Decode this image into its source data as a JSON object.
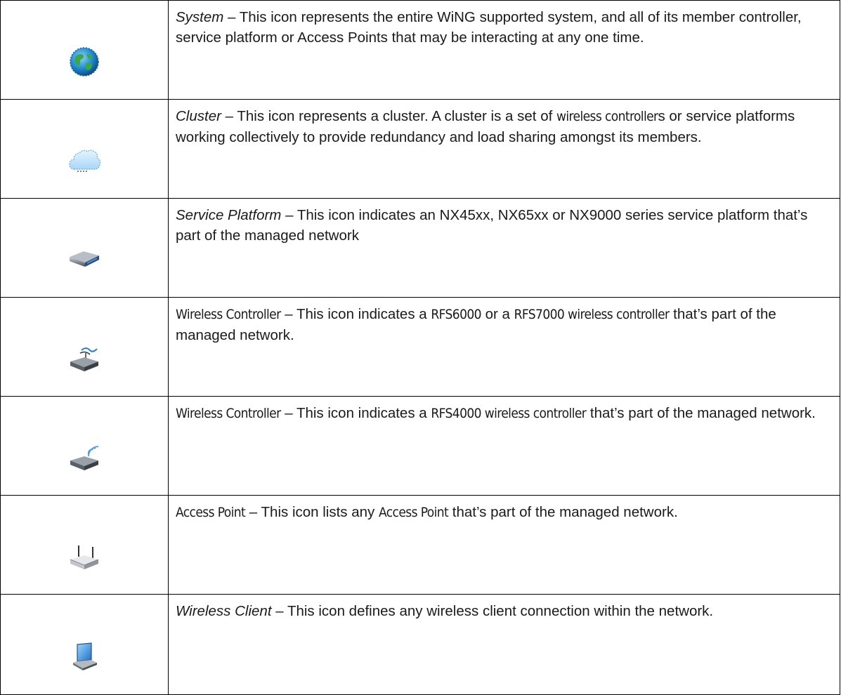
{
  "rows": [
    {
      "icon": "globe-icon",
      "term": "System",
      "desc": " – This icon represents the entire WiNG supported system, and all of its member controller, service platform or Access Points that may be interacting at any one time."
    },
    {
      "icon": "cloud-icon",
      "term": "Cluster",
      "desc_a": " – This icon represents a cluster. A cluster is a set of ",
      "desc_b": "wireless controller",
      "desc_c": "s or service platforms working collectively to provide redundancy and load sharing amongst its members."
    },
    {
      "icon": "service-platform-icon",
      "term": "Service Platform",
      "desc": " – This icon indicates an NX45xx, NX65xx or NX9000 series service platform that’s part of the managed network"
    },
    {
      "icon": "wireless-controller-antenna-icon",
      "term": "Wireless Controller",
      "desc_a": " – This icon indicates a ",
      "desc_b": "RFS6000",
      "desc_c": " or a ",
      "desc_d": "RFS7000 wireless controller",
      "desc_e": " that’s part of the managed network."
    },
    {
      "icon": "wireless-controller-wifi-icon",
      "term": "Wireless Controller",
      "desc_a": " – This icon indicates a ",
      "desc_b": "RFS4000 wireless controller",
      "desc_c": " that’s part of the managed network."
    },
    {
      "icon": "access-point-icon",
      "term": "Access Point",
      "desc_a": " – This icon lists any ",
      "desc_b": "Access Point",
      "desc_c": " that’s part of the managed network."
    },
    {
      "icon": "laptop-icon",
      "term": "Wireless Client",
      "desc": " – This icon defines any wireless client connection within the network."
    }
  ]
}
